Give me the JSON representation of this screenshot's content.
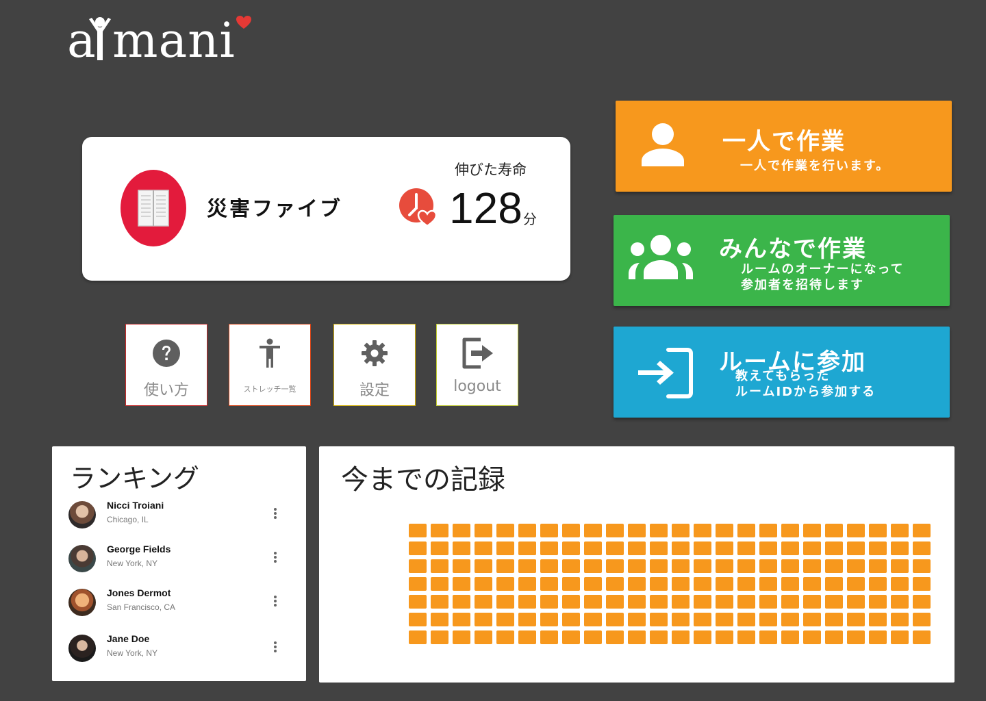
{
  "app": {
    "logo_text": "aimani",
    "accent_color": "#f7981d"
  },
  "profile": {
    "name": "災害ファイブ",
    "avatar_icon": "book-icon",
    "life_label": "伸びた寿命",
    "life_value": "128",
    "life_unit": "分"
  },
  "quick_buttons": [
    {
      "label": "使い方",
      "icon": "help-icon"
    },
    {
      "label": "ストレッチ一覧",
      "icon": "person-icon"
    },
    {
      "label": "設定",
      "icon": "gear-icon"
    },
    {
      "label": "logout",
      "icon": "logout-icon"
    }
  ],
  "actions": {
    "solo": {
      "title": "一人で作業",
      "desc_line1": "一人で作業を行います。",
      "icon": "person-icon",
      "color": "#f7981d"
    },
    "group": {
      "title": "みんなで作業",
      "desc_line1": "ルームのオーナーになって",
      "desc_line2": "参加者を招待します",
      "icon": "group-icon",
      "color": "#3bb54a"
    },
    "join": {
      "title": "ルームに参加",
      "desc_line1": "教えてもらった",
      "desc_line2": "ルームIDから参加する",
      "icon": "login-icon",
      "color": "#1ea7d2"
    }
  },
  "ranking": {
    "title": "ランキング",
    "items": [
      {
        "name": "Nicci Troiani",
        "location": "Chicago, IL"
      },
      {
        "name": "George Fields",
        "location": "New York, NY"
      },
      {
        "name": "Jones Dermot",
        "location": "San Francisco, CA"
      },
      {
        "name": "Jane Doe",
        "location": "New York, NY"
      }
    ]
  },
  "record": {
    "title": "今までの記録",
    "columns": 24,
    "rows": 7,
    "filled_cells": 168
  }
}
